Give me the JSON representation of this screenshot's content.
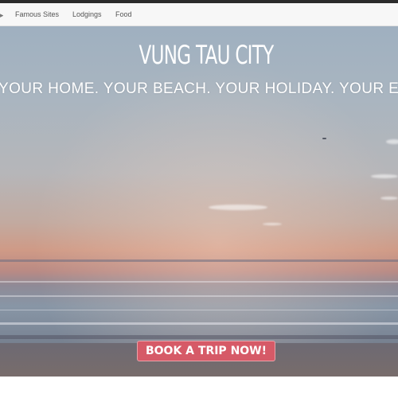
{
  "nav": {
    "items": [
      {
        "label": "Famous Sites"
      },
      {
        "label": "Lodgings"
      },
      {
        "label": "Food"
      }
    ]
  },
  "hero": {
    "title": "VUNG TAU CITY",
    "tagline": "YOUR HOME. YOUR BEACH. YOUR HOLIDAY. YOUR EVERYTHING.",
    "cta_label": "BOOK A TRIP NOW!"
  },
  "colors": {
    "cta_background": "#d65a67",
    "nav_background": "#f7f7f7",
    "topbar": "#2b2b2b"
  }
}
